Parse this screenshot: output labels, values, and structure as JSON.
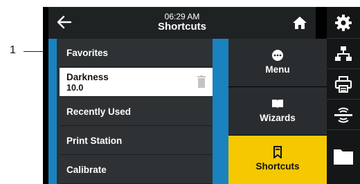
{
  "callout": {
    "number": "1"
  },
  "header": {
    "time": "06:29 AM",
    "title": "Shortcuts"
  },
  "shortcuts": {
    "items": [
      {
        "label": "Favorites"
      },
      {
        "label": "Darkness",
        "value": "10.0"
      },
      {
        "label": "Recently Used"
      },
      {
        "label": "Print Station"
      },
      {
        "label": "Calibrate"
      }
    ]
  },
  "nav": {
    "items": [
      {
        "label": "Menu",
        "icon": "menu-dots-icon"
      },
      {
        "label": "Wizards",
        "icon": "book-icon"
      },
      {
        "label": "Shortcuts",
        "icon": "bookmark-icon",
        "active": true
      }
    ]
  },
  "side": {
    "icons": [
      "gear-icon",
      "network-icon",
      "printer-icon",
      "sensor-icon",
      "folder-icon"
    ]
  },
  "colors": {
    "accent_blue": "#1a82bf",
    "active_yellow": "#f5c800",
    "panel_dark": "#2e3234"
  }
}
